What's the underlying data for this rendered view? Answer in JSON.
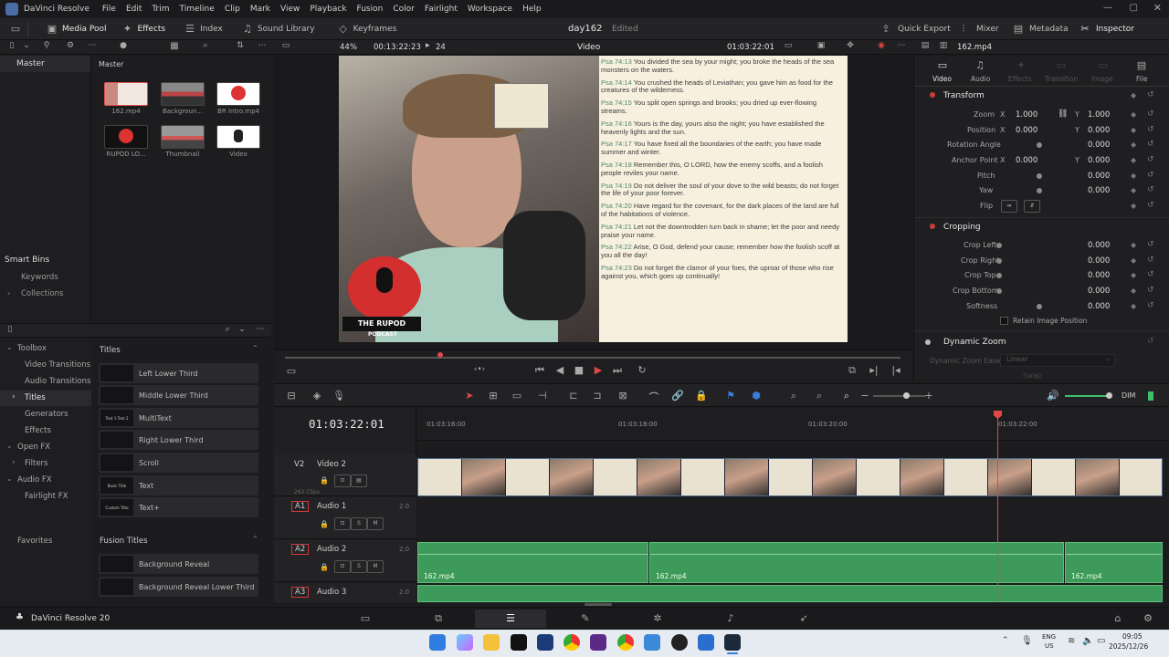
{
  "menubar": {
    "app": "DaVinci Resolve",
    "items": [
      "File",
      "Edit",
      "Trim",
      "Timeline",
      "Clip",
      "Mark",
      "View",
      "Playback",
      "Fusion",
      "Color",
      "Fairlight",
      "Workspace",
      "Help"
    ]
  },
  "toolbar": {
    "media_pool": "Media Pool",
    "effects": "Effects",
    "index": "Index",
    "sound_library": "Sound Library",
    "keyframes": "Keyframes",
    "project_title": "day162",
    "project_status": "Edited",
    "quick_export": "Quick Export",
    "mixer": "Mixer",
    "metadata": "Metadata",
    "inspector": "Inspector"
  },
  "viewer_bar": {
    "zoom": "44%",
    "timecode_left": "00:13:22:23",
    "count": "24",
    "label": "Video",
    "timecode_right": "01:03:22:01",
    "clip_name": "162.mp4"
  },
  "media_pool": {
    "root": "Master",
    "path": "Master",
    "clips": [
      {
        "name": "162.mp4"
      },
      {
        "name": "Backgroun..."
      },
      {
        "name": "BR Intro.mp4"
      },
      {
        "name": "RUPOD LO..."
      },
      {
        "name": "Thumbnail"
      },
      {
        "name": "Video"
      }
    ],
    "smart_bins": "Smart Bins",
    "smart_items": [
      "Keywords",
      "Collections"
    ]
  },
  "effects": {
    "toolbox": "Toolbox",
    "tree": [
      "Video Transitions",
      "Audio Transitions",
      "Titles",
      "Generators",
      "Effects"
    ],
    "groups": [
      "Open FX",
      "Filters",
      "Audio FX",
      "Fairlight FX"
    ],
    "favorites": "Favorites",
    "titles_header": "Titles",
    "titles": [
      {
        "name": "Left Lower Third",
        "thumb": ""
      },
      {
        "name": "Middle Lower Third",
        "thumb": ""
      },
      {
        "name": "MultiText",
        "thumb": "Text 1 Text 2"
      },
      {
        "name": "Right Lower Third",
        "thumb": ""
      },
      {
        "name": "Scroll",
        "thumb": ""
      },
      {
        "name": "Text",
        "thumb": "Basic Title"
      },
      {
        "name": "Text+",
        "thumb": "Custom Title"
      }
    ],
    "fusion_header": "Fusion Titles",
    "fusion_titles": [
      "Background Reveal",
      "Background Reveal Lower Third"
    ]
  },
  "viewer": {
    "logo_line1": "THE RUPOD",
    "logo_line2": "PODCAST",
    "verses": [
      {
        "ref": "Psa 74:13",
        "text": "You divided the sea by your might; you broke the heads of the sea monsters on the waters."
      },
      {
        "ref": "Psa 74:14",
        "text": "You crushed the heads of Leviathan; you gave him as food for the creatures of the wilderness."
      },
      {
        "ref": "Psa 74:15",
        "text": "You split open springs and brooks; you dried up ever-flowing streams."
      },
      {
        "ref": "Psa 74:16",
        "text": "Yours is the day, yours also the night; you have established the heavenly lights and the sun."
      },
      {
        "ref": "Psa 74:17",
        "text": "You have fixed all the boundaries of the earth; you have made summer and winter."
      },
      {
        "ref": "Psa 74:18",
        "text": "Remember this, O LORD, how the enemy scoffs, and a foolish people reviles your name."
      },
      {
        "ref": "Psa 74:19",
        "text": "Do not deliver the soul of your dove to the wild beasts; do not forget the life of your poor forever."
      },
      {
        "ref": "Psa 74:20",
        "text": "Have regard for the covenant, for the dark places of the land are full of the habitations of violence."
      },
      {
        "ref": "Psa 74:21",
        "text": "Let not the downtrodden turn back in shame; let the poor and needy praise your name."
      },
      {
        "ref": "Psa 74:22",
        "text": "Arise, O God, defend your cause; remember how the foolish scoff at you all the day!"
      },
      {
        "ref": "Psa 74:23",
        "text": "Do not forget the clamor of your foes, the uproar of those who rise against you, which goes up continually!"
      }
    ]
  },
  "inspector": {
    "tabs": [
      "Video",
      "Audio",
      "Effects",
      "Transition",
      "Image",
      "File"
    ],
    "transform": "Transform",
    "zoom_label": "Zoom",
    "zoom_x": "1.000",
    "zoom_y": "1.000",
    "position_label": "Position",
    "position_x": "0.000",
    "position_y": "0.000",
    "rotation_label": "Rotation Angle",
    "rotation": "0.000",
    "anchor_label": "Anchor Point",
    "anchor_x": "0.000",
    "anchor_y": "0.000",
    "pitch_label": "Pitch",
    "pitch": "0.000",
    "yaw_label": "Yaw",
    "yaw": "0.000",
    "flip_label": "Flip",
    "cropping": "Cropping",
    "crop_left_label": "Crop Left",
    "crop_left": "0.000",
    "crop_right_label": "Crop Right",
    "crop_right": "0.000",
    "crop_top_label": "Crop Top",
    "crop_top": "0.000",
    "crop_bottom_label": "Crop Bottom",
    "crop_bottom": "0.000",
    "softness_label": "Softness",
    "softness": "0.000",
    "retain": "Retain Image Position",
    "dynamic_zoom": "Dynamic Zoom",
    "dz_ease_label": "Dynamic Zoom Ease",
    "dz_ease": "Linear",
    "swap": "Swap",
    "x": "X",
    "y": "Y"
  },
  "timeline": {
    "timecode": "01:03:22:01",
    "ruler": [
      "01:03:16:00",
      "01:03:18:00",
      "01:03:20:00",
      "01:03:22:00"
    ],
    "dim": "DIM",
    "tracks": [
      {
        "id": "V2",
        "name": "Video 2",
        "sub": "262 Clips"
      },
      {
        "id": "A1",
        "name": "Audio 1",
        "level": "2.0"
      },
      {
        "id": "A2",
        "name": "Audio 2",
        "level": "2.0"
      },
      {
        "id": "A3",
        "name": "Audio 3",
        "level": "2.0"
      }
    ],
    "audio_clip": "162.mp4",
    "s": "S",
    "m": "M"
  },
  "statusbar": {
    "app": "DaVinci Resolve 20"
  },
  "taskbar": {
    "lang1": "ENG",
    "lang2": "US",
    "time": "09:05",
    "date": "2025/12/26"
  },
  "colors": {
    "accent": "#d03a3a",
    "audio": "#3e9a5a",
    "playhead": "#e04848"
  }
}
